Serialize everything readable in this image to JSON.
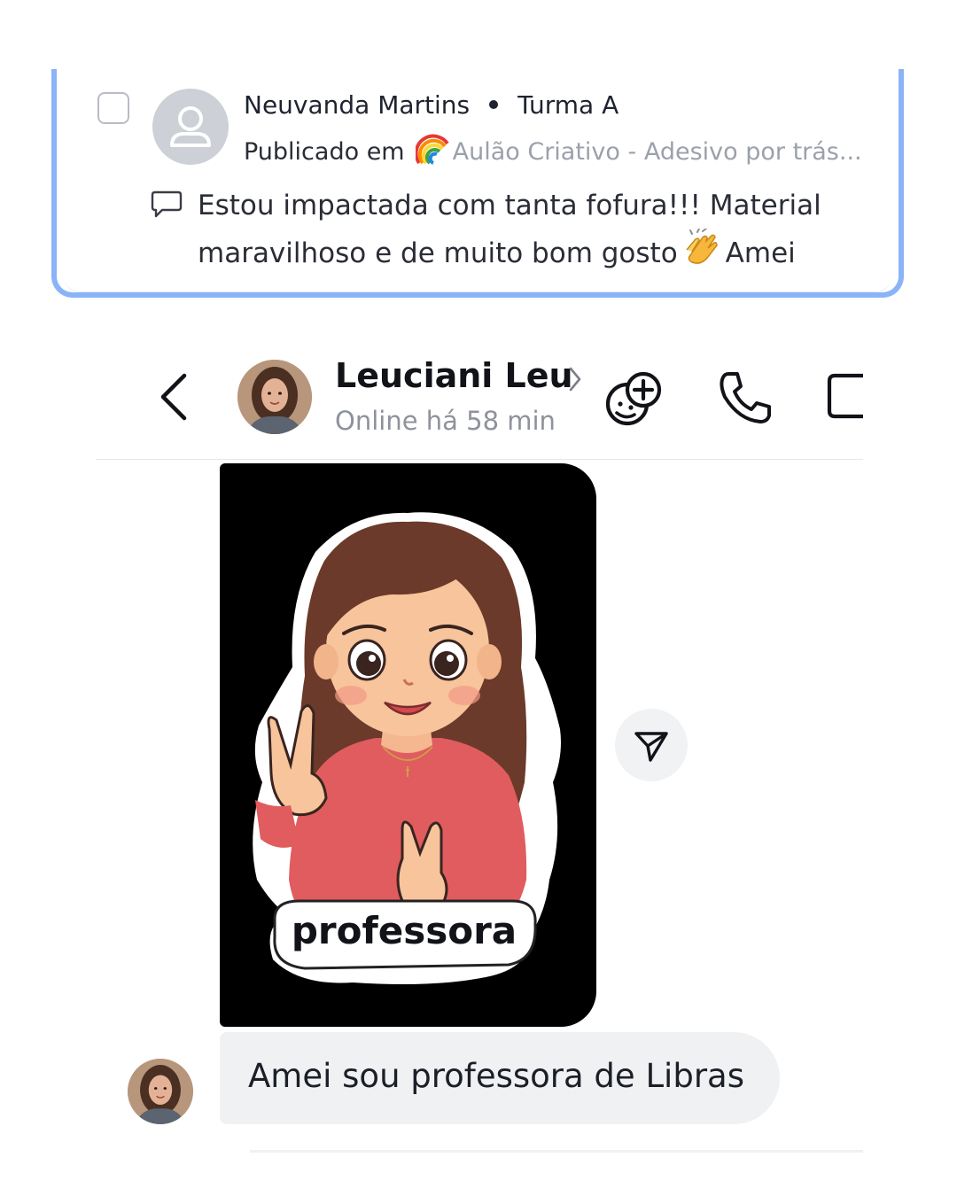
{
  "comment_card": {
    "author": "Neuvanda Martins",
    "class_name": "Turma A",
    "published_prefix": "Publicado em",
    "post_title": "Aulão Criativo - Adesivo por trás...",
    "comment_line1": "Estou impactada com tanta fofura!!! Material",
    "comment_line2_before": "maravilhoso e de muito bom gosto",
    "comment_line2_after": "Amei",
    "accent_color": "#8ab4f8"
  },
  "chat": {
    "contact_name": "Leuciani Leu",
    "status": "Online há 58 min",
    "sticker_caption": "professora",
    "message_text": "Amei sou professora de Libras",
    "bubble_color": "#f0f1f3"
  },
  "icons": [
    "checkbox-icon",
    "user-placeholder-icon",
    "rainbow-icon",
    "comment-icon",
    "clap-icon",
    "back-arrow-icon",
    "chevron-right-icon",
    "sticker-add-icon",
    "phone-icon",
    "video-icon",
    "forward-send-icon"
  ]
}
